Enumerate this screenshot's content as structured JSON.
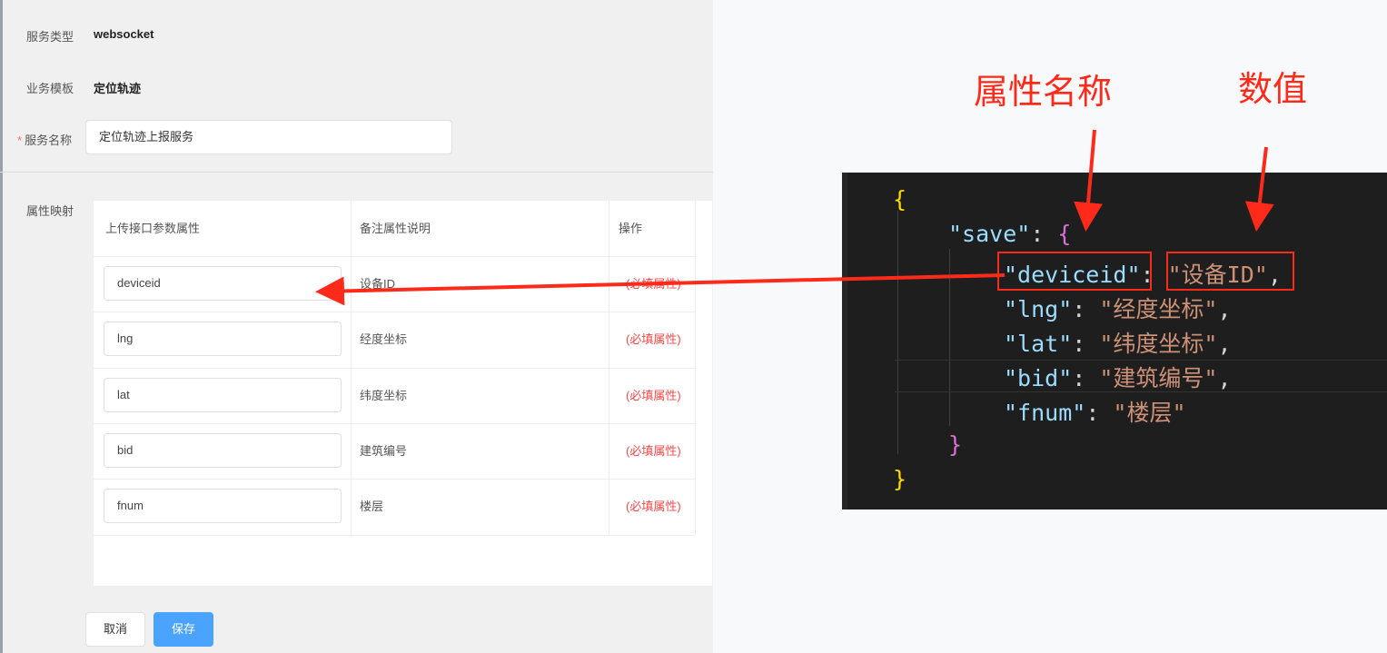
{
  "form": {
    "service_type_label": "服务类型",
    "service_type_value": "websocket",
    "biz_template_label": "业务模板",
    "biz_template_value": "定位轨迹",
    "service_name_required": "*",
    "service_name_label": "服务名称",
    "service_name_value": "定位轨迹上报服务",
    "mapping_label": "属性映射"
  },
  "table": {
    "headers": [
      "上传接口参数属性",
      "备注属性说明",
      "操作"
    ],
    "rows": [
      {
        "param": "deviceid",
        "desc": "设备ID",
        "op": "(必填属性)"
      },
      {
        "param": "lng",
        "desc": "经度坐标",
        "op": "(必填属性)"
      },
      {
        "param": "lat",
        "desc": "纬度坐标",
        "op": "(必填属性)"
      },
      {
        "param": "bid",
        "desc": "建筑编号",
        "op": "(必填属性)"
      },
      {
        "param": "fnum",
        "desc": "楼层",
        "op": "(必填属性)"
      }
    ]
  },
  "buttons": {
    "cancel": "取消",
    "save": "保存"
  },
  "annotations": {
    "attr_name": "属性名称",
    "value": "数值"
  },
  "code": {
    "open_brace": "{",
    "save_key": "\"save\"",
    "save_colon": ": ",
    "save_open": "{",
    "entries": [
      {
        "key": "\"deviceid\"",
        "sep": ": ",
        "value": "\"设备ID\"",
        "end": ","
      },
      {
        "key": "\"lng\"",
        "sep": ": ",
        "value": "\"经度坐标\"",
        "end": ","
      },
      {
        "key": "\"lat\"",
        "sep": ": ",
        "value": "\"纬度坐标\"",
        "end": ","
      },
      {
        "key": "\"bid\"",
        "sep": ": ",
        "value": "\"建筑编号\"",
        "end": ","
      },
      {
        "key": "\"fnum\"",
        "sep": ": ",
        "value": "\"楼层\"",
        "end": ""
      }
    ],
    "save_close": "}",
    "close_brace": "}"
  },
  "colors": {
    "accent": "#4aa3ff",
    "required": "#f04a4a",
    "annotation": "#ff2a1a",
    "code_bg": "#1e1e1e"
  }
}
